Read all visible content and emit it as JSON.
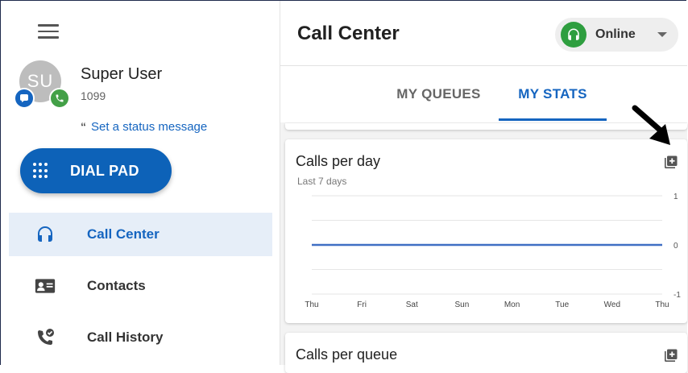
{
  "sidebar": {
    "avatar_initials": "SU",
    "user_name": "Super User",
    "extension": "1099",
    "status_quote": "“",
    "status_message": "Set a status message",
    "dial_pad_label": "DIAL PAD",
    "nav": [
      {
        "label": "Call Center",
        "icon": "headset-icon",
        "active": true
      },
      {
        "label": "Contacts",
        "icon": "contact-card-icon",
        "active": false
      },
      {
        "label": "Call History",
        "icon": "call-history-icon",
        "active": false
      }
    ]
  },
  "header": {
    "title": "Call Center",
    "presence": {
      "label": "Online",
      "color": "#2e9e3f"
    }
  },
  "tabs": [
    {
      "label": "MY QUEUES",
      "active": false
    },
    {
      "label": "MY STATS",
      "active": true
    }
  ],
  "cards": [
    {
      "title": "Calls per day",
      "subtitle": "Last 7 days"
    },
    {
      "title": "Calls per queue"
    }
  ],
  "colors": {
    "accent": "#1565c0",
    "online": "#2e9e3f"
  },
  "chart_data": {
    "type": "line",
    "title": "Calls per day",
    "subtitle": "Last 7 days",
    "categories": [
      "Thu",
      "Fri",
      "Sat",
      "Sun",
      "Mon",
      "Tue",
      "Wed",
      "Thu"
    ],
    "series": [
      {
        "values": [
          0,
          0,
          0,
          0,
          0,
          0,
          0,
          0
        ],
        "color": "#3f6fc4"
      }
    ],
    "yticks": [
      1,
      0,
      -1
    ],
    "ylim": [
      -1,
      1
    ],
    "grid": true
  }
}
